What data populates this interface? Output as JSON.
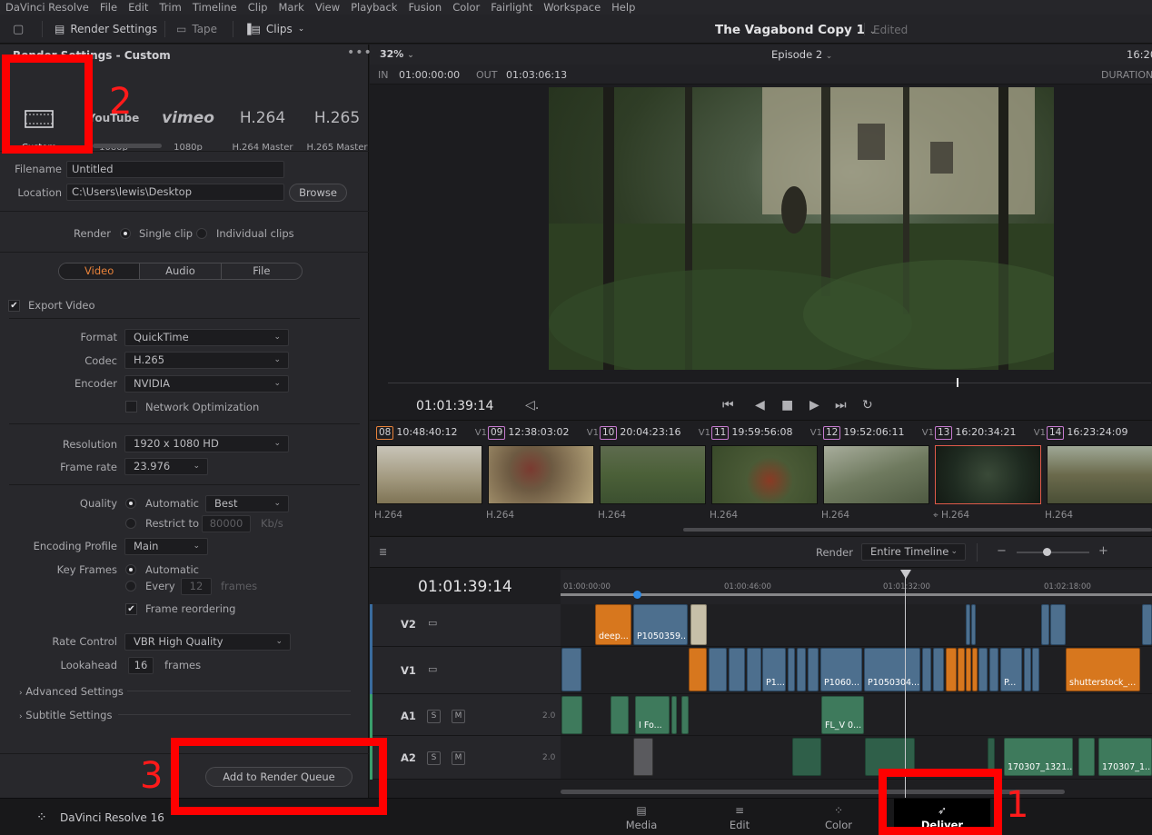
{
  "menu": [
    "DaVinci Resolve",
    "File",
    "Edit",
    "Trim",
    "Timeline",
    "Clip",
    "Mark",
    "View",
    "Playback",
    "Fusion",
    "Color",
    "Fairlight",
    "Workspace",
    "Help"
  ],
  "toolbar": {
    "render_settings": "Render Settings",
    "tape": "Tape",
    "clips": "Clips",
    "project_title": "The Vagabond Copy 1",
    "project_status": "Edited"
  },
  "render_panel": {
    "title": "Render Settings - Custom",
    "presets": [
      {
        "top": "",
        "label": "Custom"
      },
      {
        "top": "YouTube",
        "label": "1080p"
      },
      {
        "top": "vimeo",
        "label": "1080p"
      },
      {
        "top": "H.264",
        "label": "H.264 Master"
      },
      {
        "top": "H.265",
        "label": "H.265 Master"
      }
    ],
    "filename_label": "Filename",
    "filename_value": "Untitled",
    "location_label": "Location",
    "location_value": "C:\\Users\\lewis\\Desktop",
    "browse": "Browse",
    "render_label": "Render",
    "single_clip": "Single clip",
    "individual_clips": "Individual clips",
    "tabs": [
      "Video",
      "Audio",
      "File"
    ],
    "export_video": "Export Video",
    "format_label": "Format",
    "format_value": "QuickTime",
    "codec_label": "Codec",
    "codec_value": "H.265",
    "encoder_label": "Encoder",
    "encoder_value": "NVIDIA",
    "network_optimization": "Network Optimization",
    "resolution_label": "Resolution",
    "resolution_value": "1920 x 1080 HD",
    "framerate_label": "Frame rate",
    "framerate_value": "23.976",
    "quality_label": "Quality",
    "quality_auto": "Automatic",
    "quality_value": "Best",
    "restrict_to": "Restrict to",
    "restrict_value": "80000",
    "restrict_unit": "Kb/s",
    "encoding_profile_label": "Encoding Profile",
    "encoding_profile_value": "Main",
    "key_frames_label": "Key Frames",
    "key_frames_auto": "Automatic",
    "key_frames_every": "Every",
    "key_frames_every_value": "12",
    "key_frames_unit": "frames",
    "frame_reordering": "Frame reordering",
    "rate_control_label": "Rate Control",
    "rate_control_value": "VBR High Quality",
    "lookahead_label": "Lookahead",
    "lookahead_value": "16",
    "lookahead_unit": "frames",
    "advanced_settings": "Advanced Settings",
    "subtitle_settings": "Subtitle Settings",
    "add_to_queue": "Add to Render Queue"
  },
  "viewer": {
    "zoom": "32%",
    "timeline_name": "Episode 2",
    "timecode_right": "16:20",
    "in_label": "IN",
    "in_value": "01:00:00:00",
    "out_label": "OUT",
    "out_value": "01:03:06:13",
    "duration_label": "DURATION",
    "current_tc": "01:01:39:14"
  },
  "clips": [
    {
      "num": "08",
      "tc": "10:48:40:12",
      "track": "V1",
      "codec": "H.264",
      "color": "#e8823a"
    },
    {
      "num": "09",
      "tc": "12:38:03:02",
      "track": "V1",
      "codec": "H.264",
      "color": "#c77bd0"
    },
    {
      "num": "10",
      "tc": "20:04:23:16",
      "track": "V1",
      "codec": "H.264",
      "color": "#c77bd0"
    },
    {
      "num": "11",
      "tc": "19:59:56:08",
      "track": "V1",
      "codec": "H.264",
      "color": "#c77bd0"
    },
    {
      "num": "12",
      "tc": "19:52:06:11",
      "track": "V1",
      "codec": "H.264",
      "color": "#c77bd0"
    },
    {
      "num": "13",
      "tc": "16:20:34:21",
      "track": "V1",
      "codec": "H.264",
      "color": "#c77bd0"
    },
    {
      "num": "14",
      "tc": "16:23:24:09",
      "track": "V1",
      "codec": "H.264",
      "color": "#c77bd0"
    }
  ],
  "timeline": {
    "render_label": "Render",
    "render_value": "Entire Timeline",
    "timecode": "01:01:39:14",
    "ruler": [
      "01:00:00:00",
      "01:00:46:00",
      "01:01:32:00",
      "01:02:18:00"
    ],
    "tracks": [
      {
        "name": "V2"
      },
      {
        "name": "V1"
      },
      {
        "name": "A1",
        "level": "2.0"
      },
      {
        "name": "A2",
        "level": "2.0"
      }
    ],
    "clip_labels": {
      "v2_a": "deep...",
      "v2_b": "P1050359...",
      "v1_a": "P1...",
      "v1_b": "P1060...",
      "v1_c": "P1050304...",
      "v1_d": "P...",
      "v1_e": "shutterstock_...",
      "a1_a": "I Fo...",
      "a1_b": "FL_V 0...",
      "a2_a": "170307_1321...",
      "a2_b": "170307_1..."
    },
    "solo": "S",
    "mute": "M"
  },
  "app_name": "DaVinci Resolve 16",
  "pages": [
    "Media",
    "Edit",
    "Color",
    "Deliver"
  ],
  "annotations": [
    "1",
    "2",
    "3"
  ]
}
